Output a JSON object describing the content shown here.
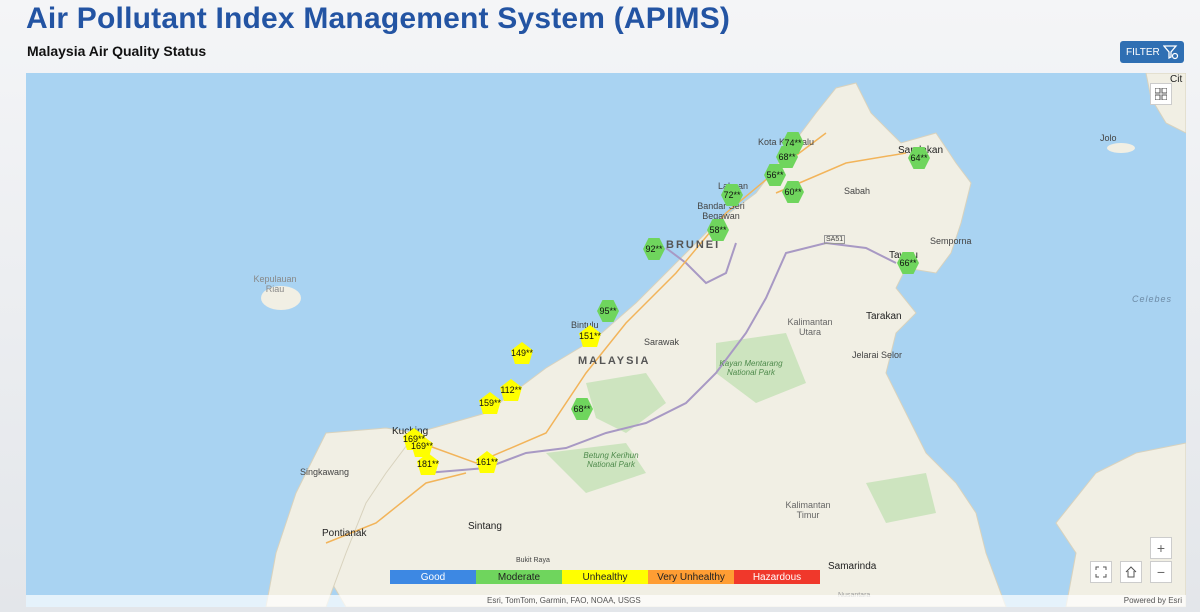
{
  "header": {
    "title": "Air Pollutant Index Management System (APIMS)",
    "subtitle": "Malaysia Air Quality Status",
    "filter_label": "FILTER"
  },
  "colors": {
    "good": "#3d88e3",
    "moderate": "#6fd55d",
    "unhealthy": "#ffff00",
    "very_unhealthy": "#ff9d33",
    "hazardous": "#f0382b"
  },
  "legend": [
    "Good",
    "Moderate",
    "Unhealthy",
    "Very Unhealthy",
    "Hazardous"
  ],
  "place_labels": {
    "cit": "Cit",
    "sandakan": "Sandakan",
    "jolo": "Jolo",
    "kota_kinabalu": "Kota Kinabalu",
    "labuan": "Labuan",
    "sabah": "Sabah",
    "bandar_seri_begawan": "Bandar Seri Begawan",
    "brunei": "BRUNEI",
    "sa51": "SA51",
    "semporna": "Semporna",
    "tawau": "Tawau",
    "kepulauan_riau": "Kepulauan Riau",
    "celebes": "Celebes",
    "tarakan": "Tarakan",
    "bintulu": "Bintulu",
    "sarawak": "Sarawak",
    "kalimantan_utara": "Kalimantan Utara",
    "malaysia": "MALAYSIA",
    "kayan_mentarang": "Kayan Mentarang National Park",
    "jelarai_selor": "Jelarai Selor",
    "kuching": "Kuching",
    "singkawang": "Singkawang",
    "betung_kerihun": "Betung Kerihun National Park",
    "kalimantan_timur": "Kalimantan Timur",
    "sintang": "Sintang",
    "pontianak": "Pontianak",
    "bukit_raya": "Bukit Raya",
    "samarinda": "Samarinda",
    "nusantara": "Nusantara"
  },
  "stations": [
    {
      "value": "74**",
      "status": "moderate"
    },
    {
      "value": "68**",
      "status": "moderate"
    },
    {
      "value": "56**",
      "status": "moderate"
    },
    {
      "value": "60**",
      "status": "moderate"
    },
    {
      "value": "72**",
      "status": "moderate"
    },
    {
      "value": "64**",
      "status": "moderate"
    },
    {
      "value": "58**",
      "status": "moderate"
    },
    {
      "value": "92**",
      "status": "moderate"
    },
    {
      "value": "66**",
      "status": "moderate"
    },
    {
      "value": "95**",
      "status": "moderate"
    },
    {
      "value": "151**",
      "status": "unhealthy"
    },
    {
      "value": "149**",
      "status": "unhealthy"
    },
    {
      "value": "112**",
      "status": "unhealthy"
    },
    {
      "value": "159**",
      "status": "unhealthy"
    },
    {
      "value": "68**",
      "status": "moderate"
    },
    {
      "value": "169**",
      "status": "unhealthy"
    },
    {
      "value": "169**",
      "status": "unhealthy"
    },
    {
      "value": "181**",
      "status": "unhealthy"
    },
    {
      "value": "161**",
      "status": "unhealthy"
    }
  ],
  "attribution": {
    "sources": "Esri, TomTom, Garmin, FAO, NOAA, USGS",
    "powered": "Powered by Esri"
  }
}
